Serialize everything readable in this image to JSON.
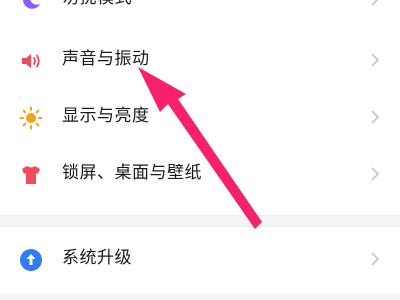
{
  "settings": {
    "items": [
      {
        "label": "勿扰模式",
        "icon": "moon-icon"
      },
      {
        "label": "声音与振动",
        "icon": "speaker-icon"
      },
      {
        "label": "显示与亮度",
        "icon": "sun-icon"
      },
      {
        "label": "锁屏、桌面与壁纸",
        "icon": "tshirt-icon"
      },
      {
        "label": "系统升级",
        "icon": "upload-arrow-icon"
      }
    ]
  },
  "colors": {
    "moon": "#8b5cf6",
    "speaker": "#f04a5b",
    "sun": "#f7a21b",
    "tshirt": "#f04a5b",
    "update": "#2f7cf6",
    "annotation_arrow": "#f6206b",
    "chevron": "#c4c4c8"
  }
}
